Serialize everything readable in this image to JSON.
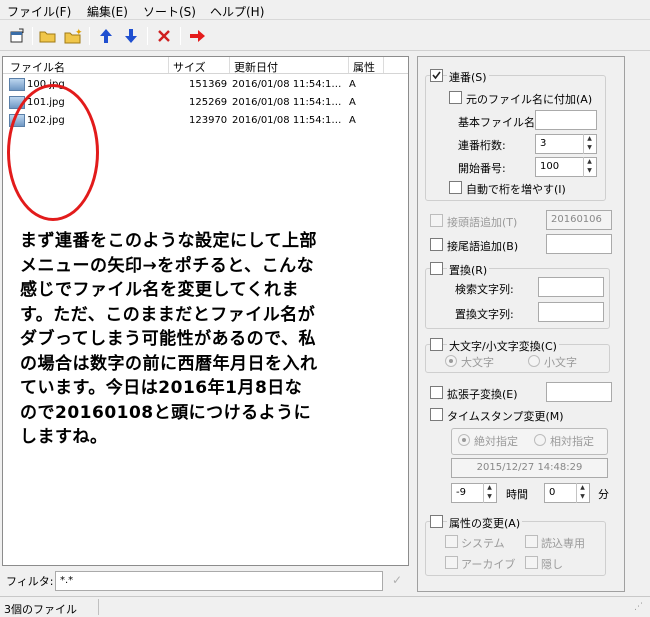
{
  "menu": [
    "ファイル(F)",
    "編集(E)",
    "ソート(S)",
    "ヘルプ(H)"
  ],
  "toolbar_icons": [
    "window-icon",
    "folder-open-icon",
    "folder-star-icon",
    "arrow-up-icon",
    "arrow-down-icon",
    "delete-icon",
    "run-arrow-icon"
  ],
  "columns": [
    "ファイル名",
    "サイズ",
    "更新日付",
    "属性"
  ],
  "files": [
    {
      "name": "100.jpg",
      "size": "151369",
      "date": "2016/01/08 11:54:1…",
      "attr": "A"
    },
    {
      "name": "101.jpg",
      "size": "125269",
      "date": "2016/01/08 11:54:1…",
      "attr": "A"
    },
    {
      "name": "102.jpg",
      "size": "123970",
      "date": "2016/01/08 11:54:1…",
      "attr": "A"
    }
  ],
  "note_lines": [
    "まず連番をこのような設定にして上部",
    "メニューの矢印→をポチると、こんな",
    "感じでファイル名を変更してくれま",
    "す。ただ、このままだとファイル名が",
    "ダブってしまう可能性があるので、私",
    "の場合は数字の前に西暦年月日を入れ",
    "ています。今日は2016年1月8日な",
    "ので20160108と頭につけるように",
    "しますね。"
  ],
  "filter": {
    "label": "フィルタ:",
    "value": "*.*"
  },
  "status": "3個のファイル",
  "options": {
    "renban": {
      "label": "連番(S)",
      "checked": true
    },
    "append_original": {
      "label": "元のファイル名に付加(A)"
    },
    "base_name_label": "基本ファイル名:",
    "digits_label": "連番桁数:",
    "digits_value": "3",
    "start_label": "開始番号:",
    "start_value": "100",
    "auto_digits": {
      "label": "自動で桁を増やす(I)"
    },
    "prefix": {
      "label": "接頭語追加(T)",
      "value": "20160106"
    },
    "suffix": {
      "label": "接尾語追加(B)"
    },
    "replace": {
      "label": "置換(R)",
      "search_label": "検索文字列:",
      "replace_label": "置換文字列:"
    },
    "case": {
      "label": "大文字/小文字変換(C)",
      "upper": "大文字",
      "lower": "小文字"
    },
    "ext": {
      "label": "拡張子変換(E)"
    },
    "timestamp": {
      "label": "タイムスタンプ変更(M)",
      "absolute": "絶対指定",
      "relative": "相対指定",
      "datetime": "2015/12/27 14:48:29",
      "hours": "-9",
      "hours_unit": "時間",
      "minutes": "0",
      "minutes_unit": "分"
    },
    "attrs": {
      "label": "属性の変更(A)",
      "system": "システム",
      "readonly": "読込専用",
      "archive": "アーカイブ",
      "hidden": "隠し"
    }
  }
}
